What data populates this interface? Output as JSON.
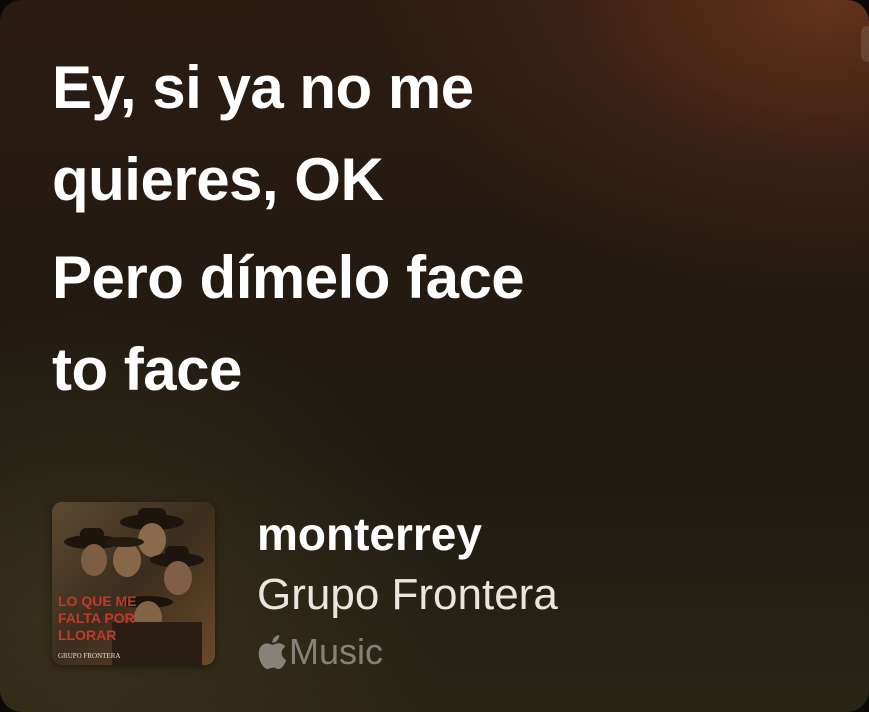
{
  "lyrics": {
    "lines": [
      "Ey, si ya no me\nquieres, OK",
      "Pero dímelo face\nto face"
    ]
  },
  "now_playing": {
    "song_title": "monterrey",
    "artist": "Grupo Frontera",
    "service_label": "Music",
    "service_icon": "apple-icon",
    "artwork": {
      "album_text_line1": "LO QUE ME",
      "album_text_line2": "FALTA POR",
      "album_text_line3": "LLORAR",
      "band_text": "GRUPO FRONTERA",
      "accent_color": "#c0392b"
    }
  },
  "colors": {
    "primary_text": "#ffffff",
    "secondary_text": "#e9e6df",
    "tertiary_text": "rgba(255,255,255,0.42)"
  }
}
